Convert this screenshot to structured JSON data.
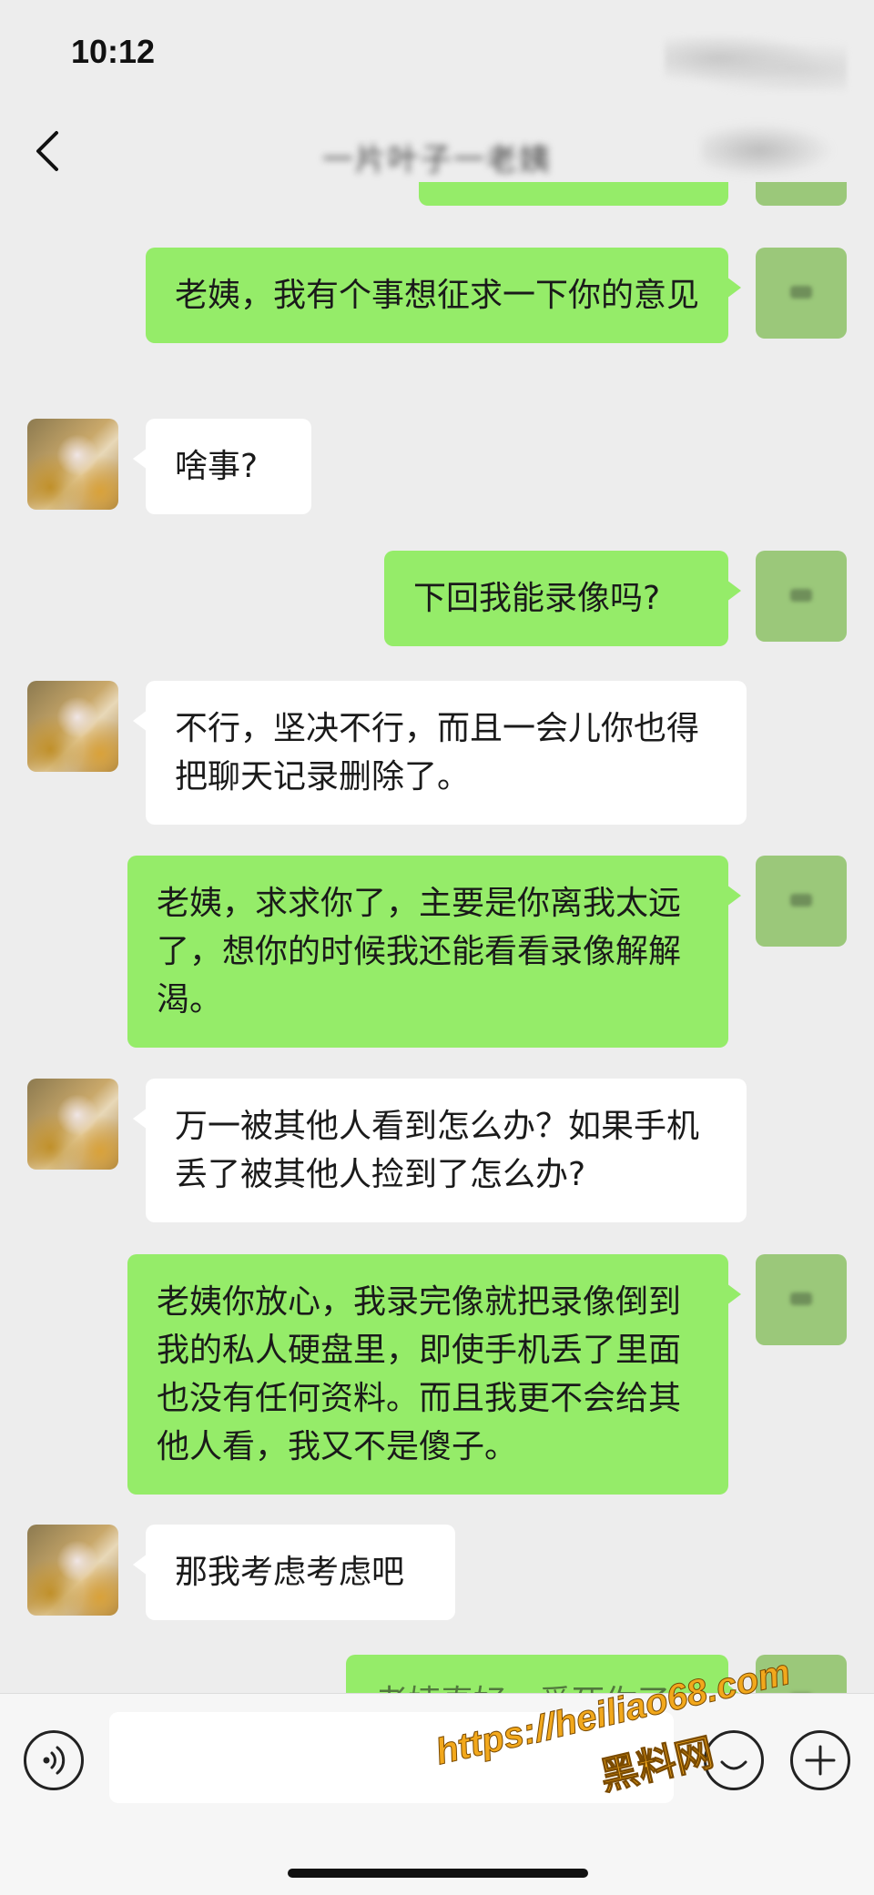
{
  "status_bar": {
    "time": "10:12"
  },
  "header": {
    "back_icon": "chevron-left-icon",
    "title": "一片叶子一老姨"
  },
  "messages": [
    {
      "side": "right",
      "text": "老姨，我有个事想征求一下你的意见"
    },
    {
      "side": "left",
      "text": "啥事?"
    },
    {
      "side": "right",
      "text": "下回我能录像吗?"
    },
    {
      "side": "left",
      "text": "不行，坚决不行，而且一会儿你也得把聊天记录删除了。"
    },
    {
      "side": "right",
      "text": "老姨，求求你了，主要是你离我太远了，想你的时候我还能看看录像解解渴。"
    },
    {
      "side": "left",
      "text": "万一被其他人看到怎么办？如果手机丢了被其他人捡到了怎么办?"
    },
    {
      "side": "right",
      "text": "老姨你放心，我录完像就把录像倒到我的私人硬盘里，即使手机丢了里面也没有任何资料。而且我更不会给其他人看，我又不是傻子。"
    },
    {
      "side": "left",
      "text": "那我考虑考虑吧"
    },
    {
      "side": "right",
      "text": "老姨真好，爱死你了"
    }
  ],
  "input_bar": {
    "voice_icon": "voice-icon",
    "text_value": "",
    "emoji_icon": "emoji-icon",
    "plus_icon": "plus-icon"
  },
  "watermark": {
    "url": "https://heiliao68.com",
    "name": "黑料网"
  },
  "colors": {
    "background": "#ededed",
    "sent_bubble": "#95ec69",
    "received_bubble": "#ffffff",
    "watermark": "#f2a81c"
  }
}
